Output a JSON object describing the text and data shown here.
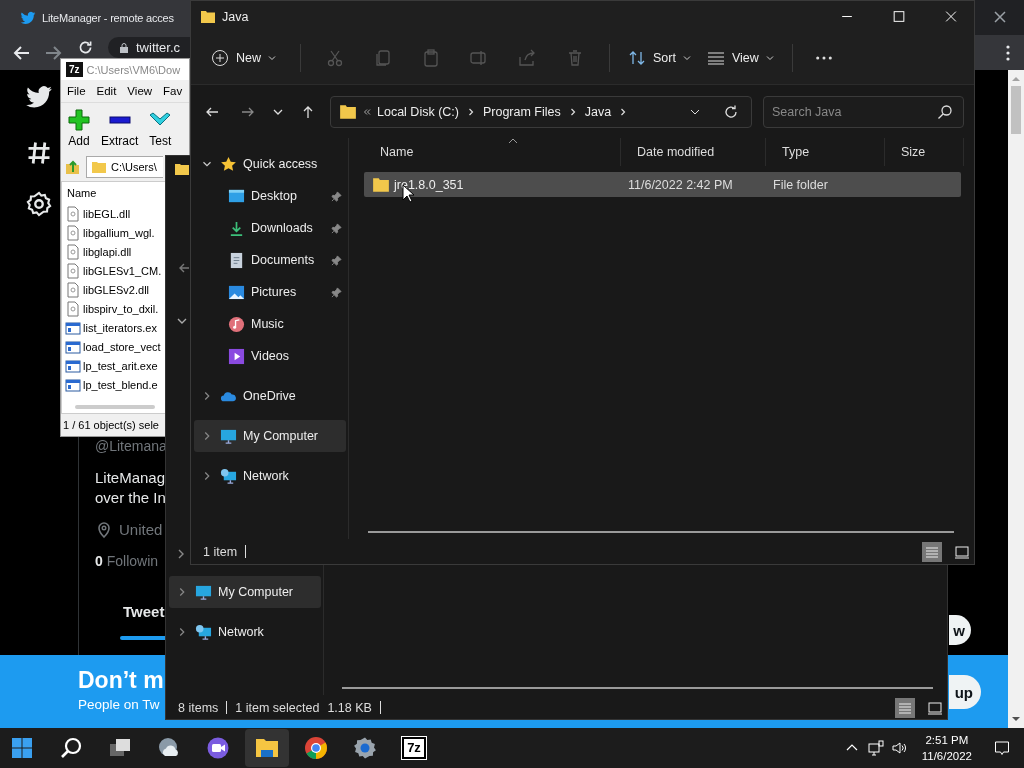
{
  "browser": {
    "tab_title": "LiteManager - remote acces",
    "address": "twitter.c",
    "profile": {
      "handle": "@Litemana",
      "bio": [
        "LiteManag",
        "over the In"
      ],
      "location": "United",
      "following_count": "0",
      "following_label": "Followin",
      "tab": "Tweet"
    },
    "banner": {
      "title": "Don’t m",
      "subtitle": "People on Tw"
    },
    "pills": [
      "w",
      "up"
    ]
  },
  "archiver": {
    "logo": "7z",
    "title": "C:\\Users\\VM6\\Dow",
    "menu": [
      "File",
      "Edit",
      "View",
      "Fav"
    ],
    "tools": [
      {
        "kind": "add",
        "label": "Add"
      },
      {
        "kind": "extract",
        "label": "Extract"
      },
      {
        "kind": "test",
        "label": "Test"
      }
    ],
    "path": "C:\\Users\\",
    "column": "Name",
    "files": [
      {
        "name": "libEGL.dll",
        "kind": "dll"
      },
      {
        "name": "libgallium_wgl.",
        "kind": "dll"
      },
      {
        "name": "libglapi.dll",
        "kind": "dll"
      },
      {
        "name": "libGLESv1_CM.",
        "kind": "dll"
      },
      {
        "name": "libGLESv2.dll",
        "kind": "dll"
      },
      {
        "name": "libspirv_to_dxil.",
        "kind": "dll"
      },
      {
        "name": "list_iterators.ex",
        "kind": "exe"
      },
      {
        "name": "load_store_vect",
        "kind": "exe"
      },
      {
        "name": "lp_test_arit.exe",
        "kind": "exe"
      },
      {
        "name": "lp_test_blend.e",
        "kind": "exe"
      }
    ],
    "status": "1 / 61 object(s) sele"
  },
  "back_explorer": {
    "sidebar": [
      {
        "label": "My Computer",
        "kind": "computer",
        "selected": true
      },
      {
        "label": "Network",
        "kind": "network",
        "selected": false
      }
    ],
    "status": {
      "items": "8 items",
      "selection": "1 item selected",
      "size": "1.18 KB"
    }
  },
  "explorer": {
    "title": "Java",
    "new": "New",
    "actions": [
      {
        "kind": "cut",
        "disabled": true
      },
      {
        "kind": "copy",
        "disabled": true
      },
      {
        "kind": "paste",
        "disabled": true
      },
      {
        "kind": "rename",
        "disabled": true
      },
      {
        "kind": "share",
        "disabled": true
      },
      {
        "kind": "delete",
        "disabled": true
      }
    ],
    "sort": "Sort",
    "view": "View",
    "breadcrumb": [
      "Local Disk (C:)",
      "Program Files",
      "Java"
    ],
    "search": {
      "placeholder": "Search Java"
    },
    "sidebar": [
      {
        "label": "Quick access",
        "kind": "star",
        "expanded": true,
        "selected": false,
        "children": [
          {
            "label": "Desktop",
            "kind": "desktop",
            "pinned": true,
            "selected": false
          },
          {
            "label": "Downloads",
            "kind": "downloads",
            "pinned": true,
            "selected": false
          },
          {
            "label": "Documents",
            "kind": "documents",
            "pinned": true,
            "selected": false
          },
          {
            "label": "Pictures",
            "kind": "pictures",
            "pinned": true,
            "selected": false
          },
          {
            "label": "Music",
            "kind": "music",
            "pinned": false,
            "selected": false
          },
          {
            "label": "Videos",
            "kind": "videos",
            "pinned": false,
            "selected": false
          }
        ]
      },
      {
        "label": "OneDrive",
        "kind": "cloud",
        "expanded": false,
        "selected": false
      },
      {
        "label": "My Computer",
        "kind": "computer",
        "expanded": false,
        "selected": true
      },
      {
        "label": "Network",
        "kind": "network",
        "expanded": false,
        "selected": false
      }
    ],
    "columns": [
      "Name",
      "Date modified",
      "Type",
      "Size"
    ],
    "rows": [
      {
        "name": "jre1.8.0_351",
        "date": "11/6/2022 2:42 PM",
        "type": "File folder",
        "selected": true
      }
    ],
    "status": "1 item"
  },
  "taskbar": {
    "apps": [
      {
        "kind": "start",
        "selected": false
      },
      {
        "kind": "search",
        "selected": false
      },
      {
        "kind": "taskview",
        "selected": false
      },
      {
        "kind": "widgets",
        "selected": false
      },
      {
        "kind": "chat",
        "selected": false
      },
      {
        "kind": "explorer",
        "selected": true
      },
      {
        "kind": "chrome",
        "selected": false
      },
      {
        "kind": "settings",
        "selected": false
      },
      {
        "kind": "archiver",
        "label": "7z",
        "selected": false
      }
    ],
    "time": "2:51 PM",
    "date": "11/6/2022"
  }
}
